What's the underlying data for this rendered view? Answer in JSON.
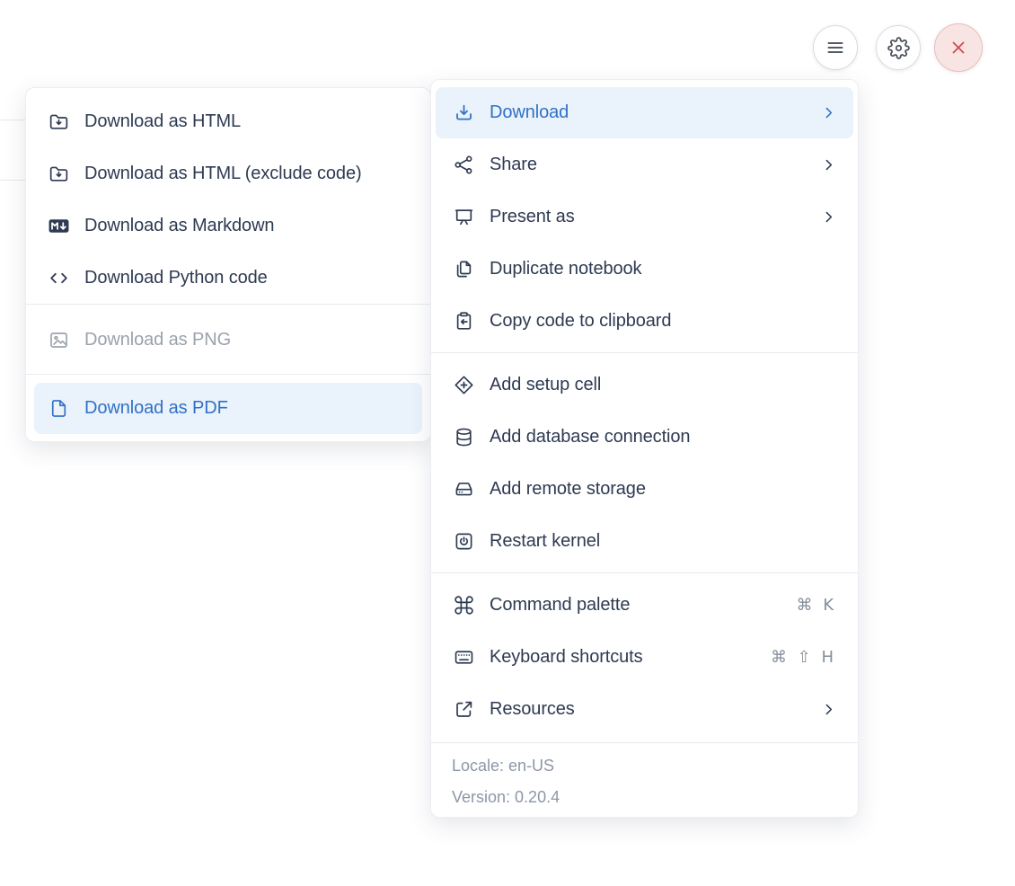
{
  "toolbar": {
    "menu_button": {
      "icon": "hamburger-icon"
    },
    "settings_button": {
      "icon": "gear-icon"
    },
    "close_button": {
      "icon": "close-icon"
    }
  },
  "download_submenu": {
    "items": [
      {
        "label": "Download as HTML",
        "icon": "folder-download-icon",
        "state": "enabled"
      },
      {
        "label": "Download as HTML (exclude code)",
        "icon": "folder-download-icon",
        "state": "enabled"
      },
      {
        "label": "Download as Markdown",
        "icon": "markdown-icon",
        "state": "enabled"
      },
      {
        "label": "Download Python code",
        "icon": "code-icon",
        "state": "enabled"
      },
      {
        "label": "Download as PNG",
        "icon": "image-icon",
        "state": "disabled"
      },
      {
        "label": "Download as PDF",
        "icon": "file-pdf-icon",
        "state": "highlighted"
      }
    ]
  },
  "main_menu": {
    "sections": [
      {
        "items": [
          {
            "label": "Download",
            "icon": "download-icon",
            "state": "highlighted",
            "submenu": true
          },
          {
            "label": "Share",
            "icon": "share-icon",
            "submenu": true
          },
          {
            "label": "Present as",
            "icon": "present-icon",
            "submenu": true
          },
          {
            "label": "Duplicate notebook",
            "icon": "duplicate-icon"
          },
          {
            "label": "Copy code to clipboard",
            "icon": "copy-clipboard-icon"
          }
        ]
      },
      {
        "items": [
          {
            "label": "Add setup cell",
            "icon": "add-setup-cell-icon"
          },
          {
            "label": "Add database connection",
            "icon": "database-icon"
          },
          {
            "label": "Add remote storage",
            "icon": "remote-storage-icon"
          },
          {
            "label": "Restart kernel",
            "icon": "restart-kernel-icon"
          }
        ]
      },
      {
        "items": [
          {
            "label": "Command palette",
            "icon": "command-icon",
            "shortcut": "⌘ K"
          },
          {
            "label": "Keyboard shortcuts",
            "icon": "keyboard-icon",
            "shortcut": "⌘ ⇧ H"
          },
          {
            "label": "Resources",
            "icon": "external-link-icon",
            "submenu": true
          }
        ]
      }
    ],
    "footer": {
      "locale": "Locale: en-US",
      "version": "Version: 0.20.4"
    }
  },
  "colors": {
    "accent_blue": "#3071c5",
    "highlight_bg": "#eaf2fc",
    "text": "#2e3a52",
    "disabled_text": "#9ba2ac",
    "muted_text": "#8d97a7",
    "divider": "#e8eaee",
    "close_bg": "#f9e4e4",
    "close_border": "#edbcbc",
    "close_x": "#ce4b50"
  }
}
